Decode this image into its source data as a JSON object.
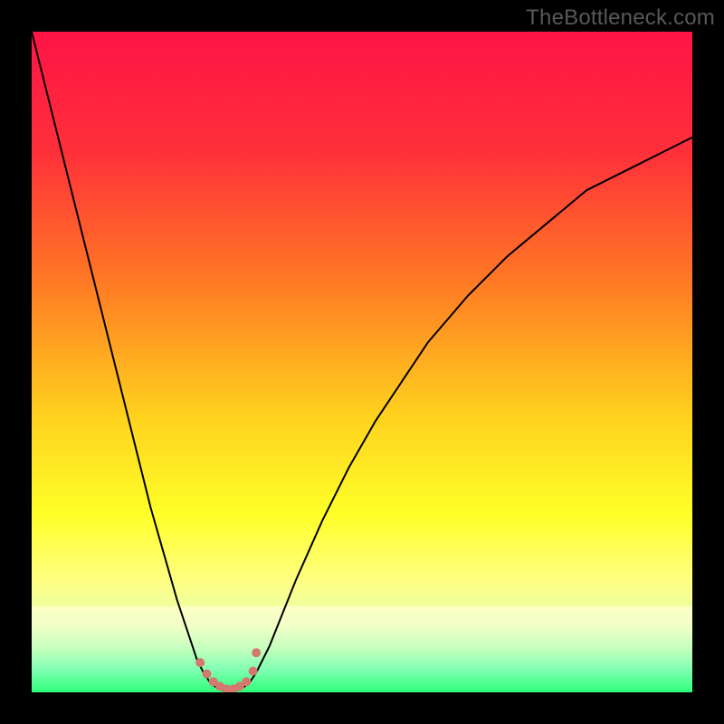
{
  "watermark": "TheBottleneck.com",
  "chart_data": {
    "type": "line",
    "title": "",
    "xlabel": "",
    "ylabel": "",
    "xlim": [
      0,
      100
    ],
    "ylim": [
      0,
      100
    ],
    "background": {
      "type": "vertical_gradient",
      "stops": [
        {
          "pos": 0,
          "color": "#ff1446"
        },
        {
          "pos": 18,
          "color": "#ff2f3a"
        },
        {
          "pos": 38,
          "color": "#ff7a24"
        },
        {
          "pos": 58,
          "color": "#ffd11e"
        },
        {
          "pos": 73,
          "color": "#ffff28"
        },
        {
          "pos": 83,
          "color": "#ffff82"
        },
        {
          "pos": 90,
          "color": "#e5ffb0"
        },
        {
          "pos": 100,
          "color": "#2eff7a"
        }
      ]
    },
    "bottom_band": {
      "stops": [
        {
          "pos": 0,
          "color": "#ffffc6"
        },
        {
          "pos": 25,
          "color": "#eeffc6"
        },
        {
          "pos": 50,
          "color": "#c3ffbe"
        },
        {
          "pos": 75,
          "color": "#7cffb0"
        },
        {
          "pos": 100,
          "color": "#2eff7a"
        }
      ]
    },
    "series": [
      {
        "name": "curve-left",
        "color": "#000000",
        "width": 2,
        "x": [
          0,
          2,
          4,
          6,
          8,
          10,
          12,
          14,
          16,
          18,
          20,
          22,
          24,
          25,
          26,
          27,
          28
        ],
        "y": [
          100,
          92,
          84,
          76,
          68,
          60,
          52,
          44,
          36,
          28,
          21,
          14,
          8,
          5,
          3,
          1.5,
          0.7
        ]
      },
      {
        "name": "curve-right",
        "color": "#000000",
        "width": 2,
        "x": [
          32,
          33,
          34,
          35,
          36,
          38,
          40,
          44,
          48,
          52,
          56,
          60,
          66,
          72,
          78,
          84,
          90,
          96,
          100
        ],
        "y": [
          0.7,
          1.5,
          3,
          5,
          7,
          12,
          17,
          26,
          34,
          41,
          47,
          53,
          60,
          66,
          71,
          76,
          79,
          82,
          84
        ]
      },
      {
        "name": "valley-floor",
        "color": "#000000",
        "width": 2,
        "x": [
          28,
          29,
          30,
          31,
          32
        ],
        "y": [
          0.7,
          0.3,
          0.2,
          0.3,
          0.7
        ]
      }
    ],
    "markers": {
      "color": "#d5776e",
      "radius": 5,
      "points": [
        {
          "x": 25.5,
          "y": 4.5
        },
        {
          "x": 26.5,
          "y": 2.8
        },
        {
          "x": 27.5,
          "y": 1.6
        },
        {
          "x": 28.5,
          "y": 0.9
        },
        {
          "x": 29.5,
          "y": 0.5
        },
        {
          "x": 30.5,
          "y": 0.5
        },
        {
          "x": 31.5,
          "y": 0.9
        },
        {
          "x": 32.5,
          "y": 1.6
        },
        {
          "x": 33.5,
          "y": 3.2
        },
        {
          "x": 34.0,
          "y": 6.0
        }
      ]
    }
  }
}
